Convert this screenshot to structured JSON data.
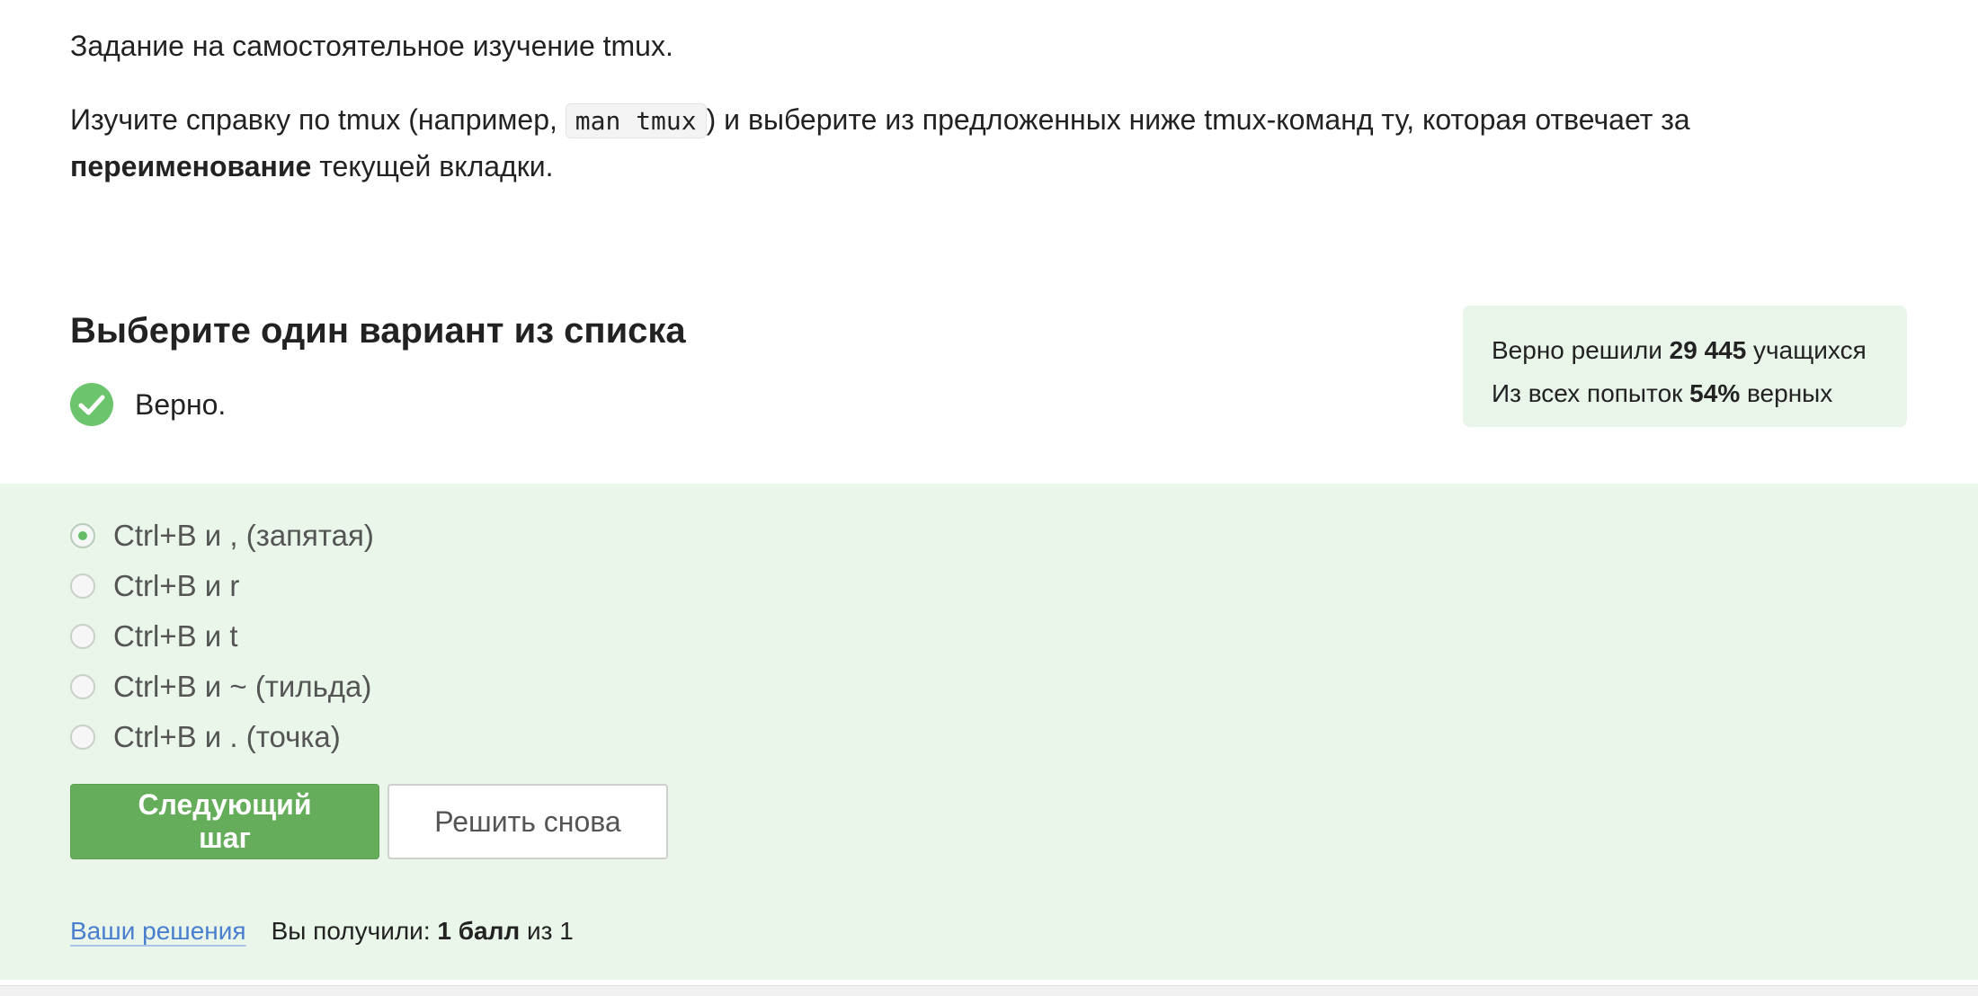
{
  "task": {
    "intro": "Задание на самостоятельное изучение tmux.",
    "instruction_before_code": "Изучите справку по tmux (например, ",
    "code": "man tmux",
    "instruction_after_code": ") и выберите из предложенных ниже tmux-команд ту, которая отвечает за",
    "emphasis": "переименование",
    "instruction_end": " текущей вкладки."
  },
  "quiz": {
    "title": "Выберите один вариант из списка",
    "verdict": "Верно."
  },
  "stats": {
    "solved_prefix": "Верно решили ",
    "solved_count": "29 445",
    "solved_suffix": " учащихся",
    "attempts_prefix": "Из всех попыток ",
    "attempts_percent": "54%",
    "attempts_suffix": " верных"
  },
  "options": [
    {
      "label": "Ctrl+B и , (запятая)",
      "checked": true
    },
    {
      "label": "Ctrl+B и r",
      "checked": false
    },
    {
      "label": "Ctrl+B и t",
      "checked": false
    },
    {
      "label": "Ctrl+B и ~ (тильда)",
      "checked": false
    },
    {
      "label": "Ctrl+B и . (точка)",
      "checked": false
    }
  ],
  "buttons": {
    "next": "Следующий шаг",
    "retry": "Решить снова"
  },
  "result": {
    "link": "Ваши решения",
    "prefix": "Вы получили: ",
    "score": "1 балл",
    "suffix": " из 1"
  },
  "colors": {
    "accent_green": "#66ad5b",
    "success_icon": "#6cc56c",
    "answer_background": "#e9f6e9",
    "link_blue": "#4a7ecf"
  }
}
